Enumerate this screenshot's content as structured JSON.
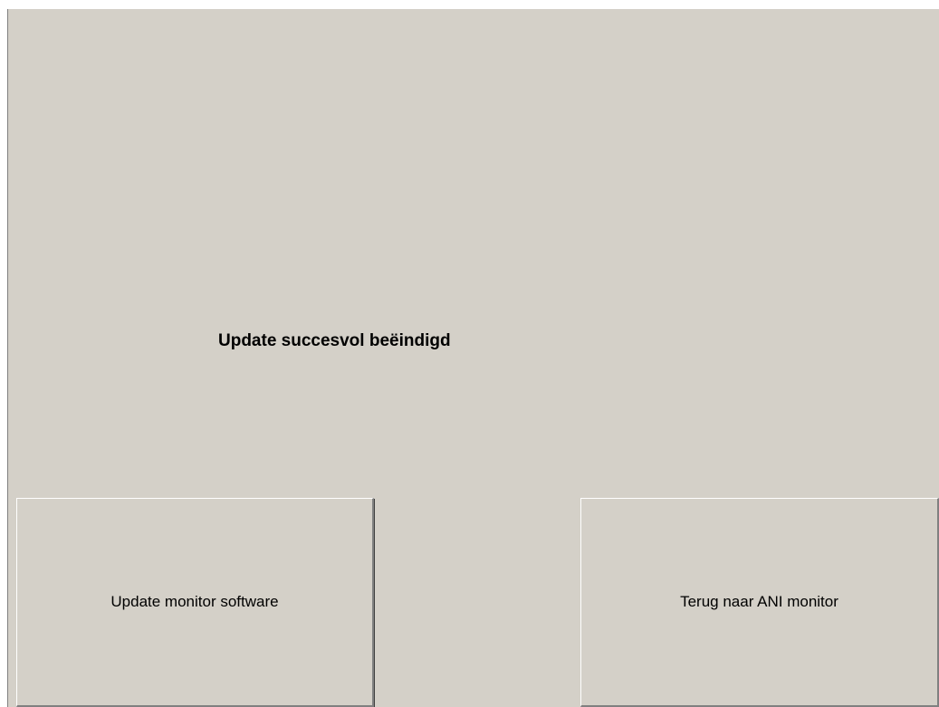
{
  "status": {
    "message": "Update succesvol beëindigd"
  },
  "buttons": {
    "update_software_label": "Update monitor software",
    "back_label": "Terug naar ANI monitor"
  }
}
